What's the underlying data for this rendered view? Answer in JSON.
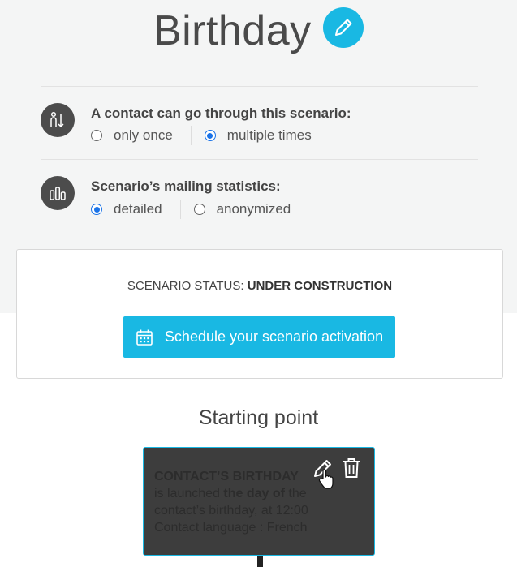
{
  "header": {
    "title": "Birthday"
  },
  "scenario_passage": {
    "label": "A contact can go through this scenario:",
    "options": [
      {
        "label": "only once",
        "selected": false
      },
      {
        "label": "multiple times",
        "selected": true
      }
    ]
  },
  "statistics": {
    "label": "Scenario’s mailing statistics:",
    "options": [
      {
        "label": "detailed",
        "selected": true
      },
      {
        "label": "anonymized",
        "selected": false
      }
    ]
  },
  "status_card": {
    "status_prefix": "SCENARIO STATUS:",
    "status_value": "UNDER CONSTRUCTION",
    "schedule_button": "Schedule your scenario activation"
  },
  "starting_point": {
    "title": "Starting point",
    "card": {
      "line1": "CONTACT’S BIRTHDAY",
      "line2_pre": "is launched ",
      "line2_strong": "the day of",
      "line2_post": " the",
      "line3": "contact’s birthday, at 12:00",
      "line4": "Contact language : French"
    }
  },
  "colors": {
    "accent": "#19b8e3",
    "radio_selected": "#1a73e8",
    "card_bg": "#3d3d3d"
  }
}
